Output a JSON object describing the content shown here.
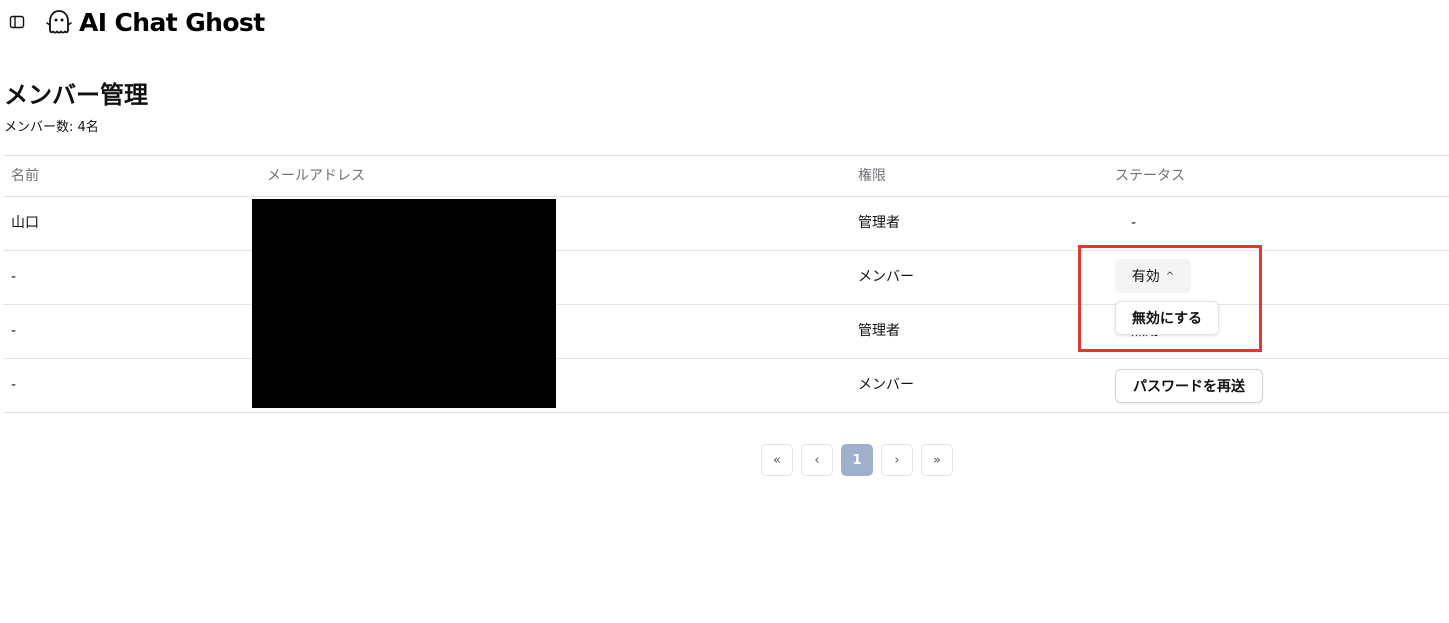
{
  "header": {
    "brand": "AI Chat Ghost",
    "icons": {
      "sidebar_toggle": "sidebar-toggle-icon",
      "logo": "ghost-icon"
    }
  },
  "page": {
    "title": "メンバー管理",
    "member_count": "メンバー数: 4名"
  },
  "table": {
    "columns": [
      "名前",
      "メールアドレス",
      "権限",
      "ステータス"
    ],
    "rows": [
      {
        "name": "山口",
        "role": "管理者",
        "status": "-"
      },
      {
        "name": "-",
        "role": "メンバー",
        "status": "有効"
      },
      {
        "name": "-",
        "role": "管理者",
        "status": "無効"
      },
      {
        "name": "-",
        "role": "メンバー",
        "status": "パスワードを再送"
      }
    ]
  },
  "status_dropdown": {
    "selected": "有効",
    "chevron": "^",
    "option": "無効にする"
  },
  "pagination": {
    "first": "«",
    "prev": "‹",
    "current": "1",
    "next": "›",
    "last": "»"
  },
  "colors": {
    "highlight": "#e5382b",
    "active_page": "#9fb0cc",
    "redaction": "#000000"
  }
}
